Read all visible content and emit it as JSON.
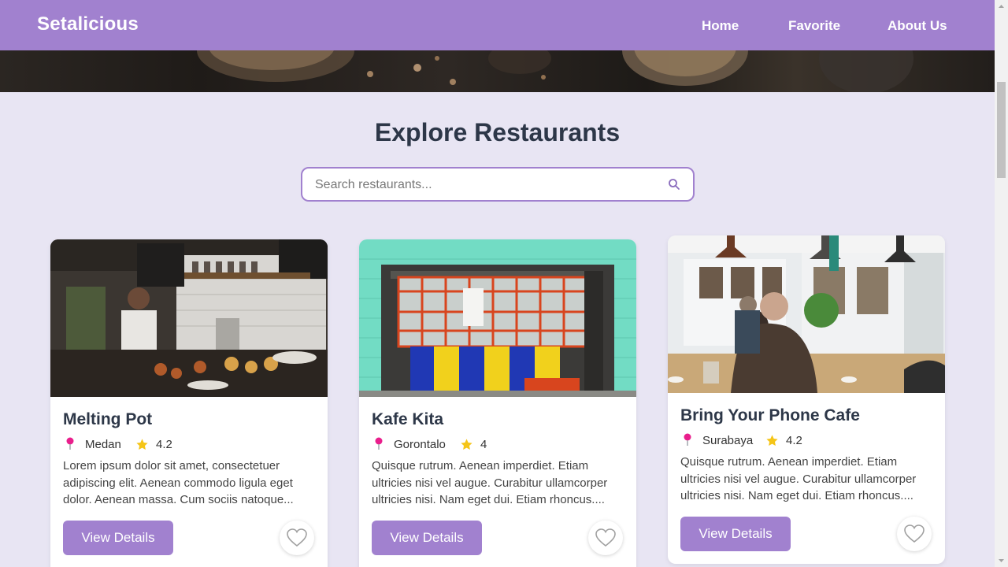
{
  "brand": "Setalicious",
  "nav": {
    "home": "Home",
    "favorite": "Favorite",
    "about": "About Us"
  },
  "section_title": "Explore Restaurants",
  "search": {
    "placeholder": "Search restaurants...",
    "value": ""
  },
  "colors": {
    "primary": "#a181cf",
    "heading": "#2d3748",
    "background": "#e8e5f3",
    "star": "#f5c518",
    "pin": "#e91e8c"
  },
  "icons": {
    "search": "search-icon",
    "location": "map-pin-icon",
    "rating": "star-icon",
    "favorite": "heart-icon"
  },
  "restaurants": [
    {
      "name": "Melting Pot",
      "city": "Medan",
      "rating": "4.2",
      "description": "Lorem ipsum dolor sit amet, consectetuer adipiscing elit. Aenean commodo ligula eget dolor. Aenean massa. Cum sociis natoque...",
      "button": "View Details"
    },
    {
      "name": "Kafe Kita",
      "city": "Gorontalo",
      "rating": "4",
      "description": "Quisque rutrum. Aenean imperdiet. Etiam ultricies nisi vel augue. Curabitur ullamcorper ultricies nisi. Nam eget dui. Etiam rhoncus....",
      "button": "View Details"
    },
    {
      "name": "Bring Your Phone Cafe",
      "city": "Surabaya",
      "rating": "4.2",
      "description": "Quisque rutrum. Aenean imperdiet. Etiam ultricies nisi vel augue. Curabitur ullamcorper ultricies nisi. Nam eget dui. Etiam rhoncus....",
      "button": "View Details"
    }
  ]
}
